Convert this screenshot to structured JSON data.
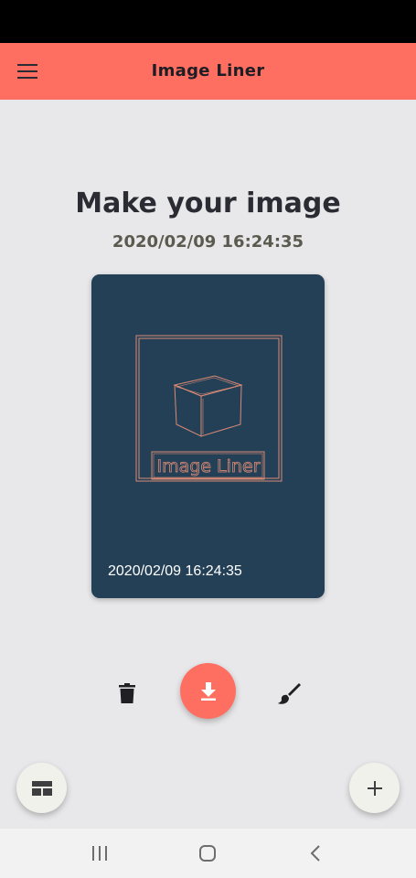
{
  "app_bar": {
    "title": "Image Liner",
    "menu_icon": "hamburger-menu-icon",
    "background": "#ff6f61"
  },
  "main": {
    "headline": "Make your image",
    "timestamp": "2020/02/09 16:24:35"
  },
  "card": {
    "background": "#244056",
    "logo_text": "Image Liner",
    "date": "2020/02/09 16:24:35"
  },
  "actions": {
    "delete_icon": "trash-icon",
    "download_icon": "download-icon",
    "edit_icon": "brush-icon",
    "accent": "#ff6f61"
  },
  "fabs": {
    "left_icon": "layout-icon",
    "right_icon": "plus-icon"
  },
  "system_nav": {
    "recents_icon": "recents-icon",
    "home_icon": "home-icon",
    "back_icon": "back-icon"
  }
}
